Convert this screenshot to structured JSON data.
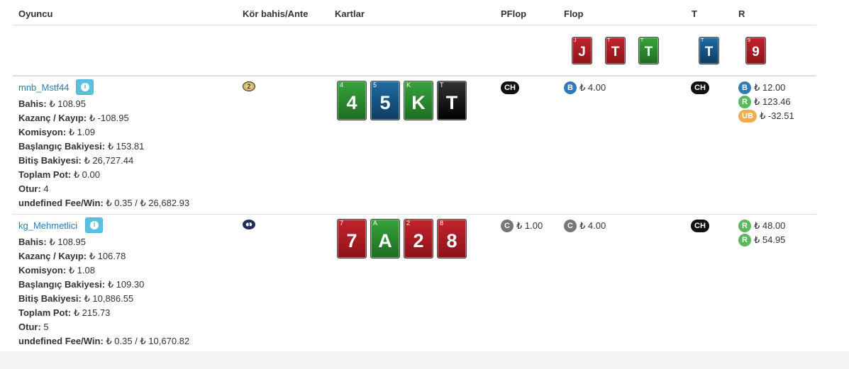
{
  "headers": {
    "player": "Oyuncu",
    "blind": "Kör bahis/Ante",
    "cards": "Kartlar",
    "preflop": "PFlop",
    "flop": "Flop",
    "turn": "T",
    "river": "R"
  },
  "board": {
    "flop": [
      {
        "rank": "J",
        "corner": "J",
        "color": "red"
      },
      {
        "rank": "T",
        "corner": "T",
        "color": "red"
      },
      {
        "rank": "T",
        "corner": "T",
        "color": "green"
      }
    ],
    "turn": [
      {
        "rank": "T",
        "corner": "T",
        "color": "blue"
      }
    ],
    "river": [
      {
        "rank": "9",
        "corner": "9",
        "color": "red"
      }
    ]
  },
  "players": [
    {
      "name": "mnb_Mstf44",
      "info_icon": "info-circle-icon",
      "position_chip": "2",
      "cards": [
        {
          "rank": "4",
          "corner": "4",
          "color": "green"
        },
        {
          "rank": "5",
          "corner": "5",
          "color": "blue"
        },
        {
          "rank": "K",
          "corner": "K",
          "color": "green"
        },
        {
          "rank": "T",
          "corner": "T",
          "color": "black"
        }
      ],
      "stats": [
        {
          "label": "Bahis:",
          "value": "₺ 108.95"
        },
        {
          "label": "Kazanç / Kayıp:",
          "value": "₺ -108.95"
        },
        {
          "label": "Komisyon:",
          "value": "₺ 1.09"
        },
        {
          "label": "Başlangıç Bakiyesi:",
          "value": "₺ 153.81"
        },
        {
          "label": "Bitiş Bakiyesi:",
          "value": "₺ 26,727.44"
        },
        {
          "label": "Toplam Pot:",
          "value": "₺ 0.00"
        },
        {
          "label": "Otur:",
          "value": "4"
        },
        {
          "label": "undefined Fee/Win:",
          "value": "₺ 0.35 / ₺ 26,682.93"
        }
      ],
      "preflop": [
        {
          "badge": "CH",
          "color": "black",
          "amount": ""
        }
      ],
      "flop": [
        {
          "badge": "B",
          "color": "blue",
          "amount": "₺ 4.00"
        }
      ],
      "turn": [
        {
          "badge": "CH",
          "color": "black",
          "amount": ""
        }
      ],
      "river": [
        {
          "badge": "B",
          "color": "blue",
          "amount": "₺ 12.00"
        },
        {
          "badge": "R",
          "color": "green",
          "amount": "₺ 123.46"
        },
        {
          "badge": "UB",
          "color": "orange",
          "amount": "₺ -32.51"
        }
      ]
    },
    {
      "name": "kg_Mehmetlici",
      "info_icon": "info-circle-icon",
      "position_chip": "1",
      "cards": [
        {
          "rank": "7",
          "corner": "7",
          "color": "red"
        },
        {
          "rank": "A",
          "corner": "A",
          "color": "green"
        },
        {
          "rank": "2",
          "corner": "2",
          "color": "red"
        },
        {
          "rank": "8",
          "corner": "8",
          "color": "red"
        }
      ],
      "stats": [
        {
          "label": "Bahis:",
          "value": "₺ 108.95"
        },
        {
          "label": "Kazanç / Kayıp:",
          "value": "₺ 106.78"
        },
        {
          "label": "Komisyon:",
          "value": "₺ 1.08"
        },
        {
          "label": "Başlangıç Bakiyesi:",
          "value": "₺ 109.30"
        },
        {
          "label": "Bitiş Bakiyesi:",
          "value": "₺ 10,886.55"
        },
        {
          "label": "Toplam Pot:",
          "value": "₺ 215.73"
        },
        {
          "label": "Otur:",
          "value": "5"
        },
        {
          "label": "undefined Fee/Win:",
          "value": "₺ 0.35 / ₺ 10,670.82"
        }
      ],
      "preflop": [
        {
          "badge": "C",
          "color": "gray",
          "amount": "₺ 1.00"
        }
      ],
      "flop": [
        {
          "badge": "C",
          "color": "gray",
          "amount": "₺ 4.00"
        }
      ],
      "turn": [
        {
          "badge": "CH",
          "color": "black",
          "amount": ""
        }
      ],
      "river": [
        {
          "badge": "R",
          "color": "green",
          "amount": "₺ 48.00"
        },
        {
          "badge": "R",
          "color": "green",
          "amount": "₺ 54.95"
        }
      ]
    }
  ]
}
